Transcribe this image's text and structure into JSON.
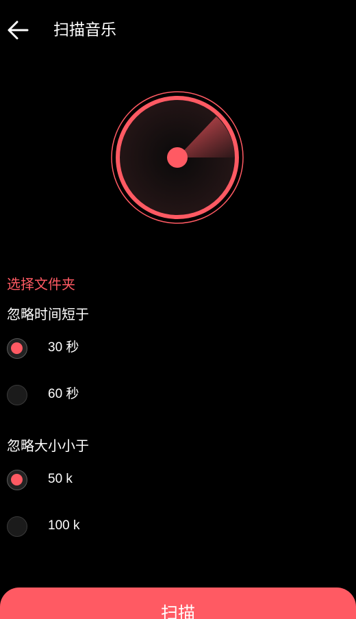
{
  "header": {
    "title": "扫描音乐"
  },
  "folder": {
    "label": "选择文件夹"
  },
  "duration": {
    "title": "忽略时间短于",
    "options": [
      {
        "label": "30 秒",
        "checked": true
      },
      {
        "label": "60 秒",
        "checked": false
      }
    ]
  },
  "size": {
    "title": "忽略大小小于",
    "options": [
      {
        "label": "50 k",
        "checked": true
      },
      {
        "label": "100 k",
        "checked": false
      }
    ]
  },
  "action": {
    "scan_label": "扫描"
  },
  "colors": {
    "accent": "#ff5a63",
    "background": "#000000"
  }
}
